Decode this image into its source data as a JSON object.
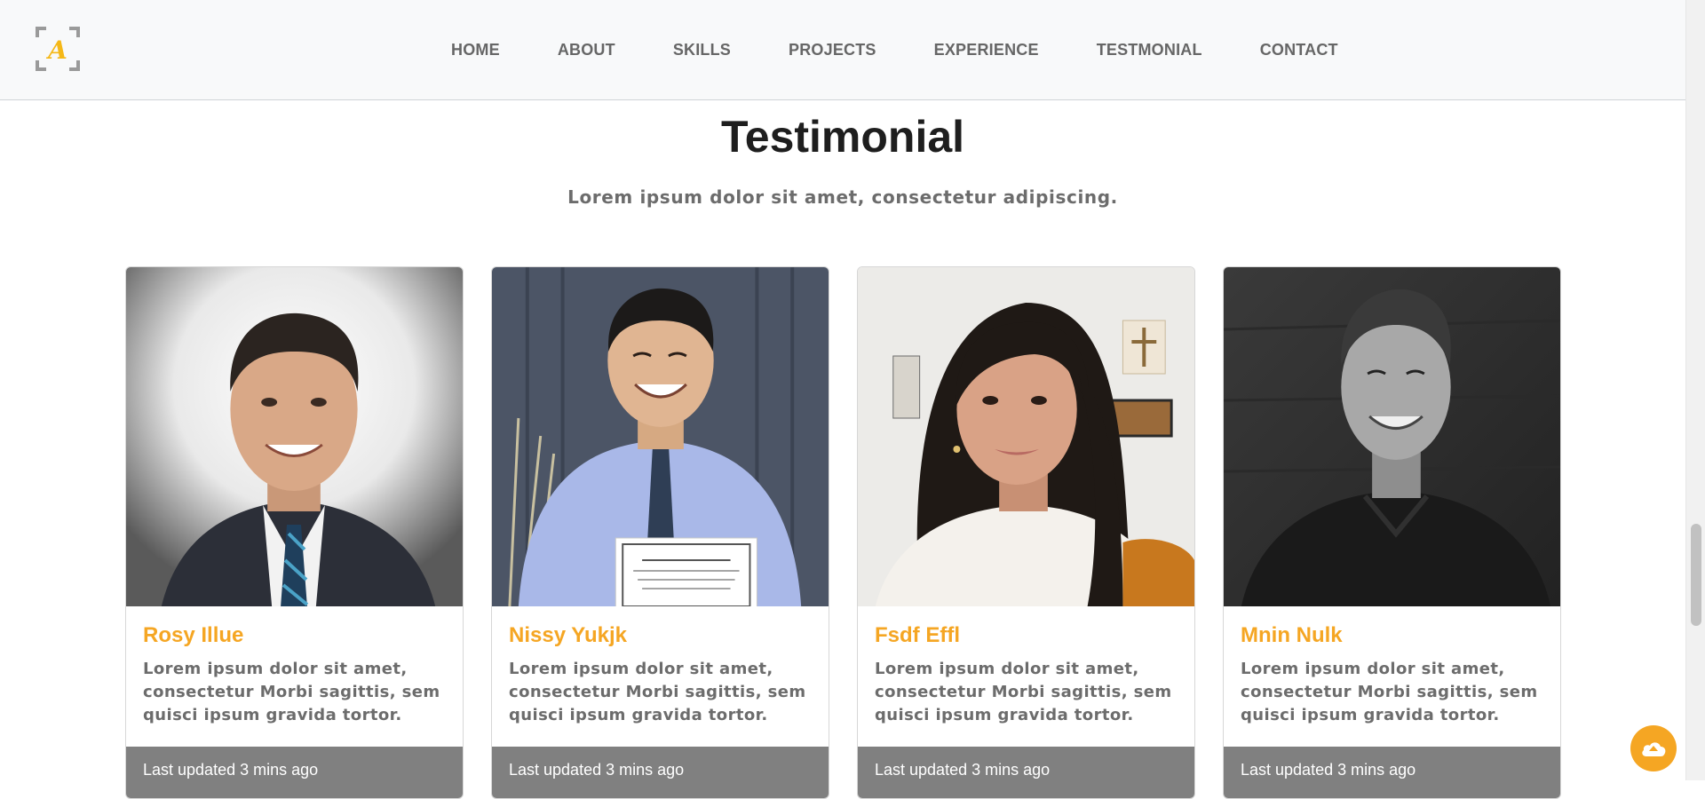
{
  "brand": {
    "logo_letter": "A",
    "accent_color": "#f5a623"
  },
  "nav": {
    "items": [
      {
        "label": "HOME"
      },
      {
        "label": "ABOUT"
      },
      {
        "label": "SKILLS"
      },
      {
        "label": "PROJECTS"
      },
      {
        "label": "EXPERIENCE"
      },
      {
        "label": "TESTMONIAL"
      },
      {
        "label": "CONTACT"
      }
    ]
  },
  "section": {
    "title": "Testimonial",
    "subtitle": "Lorem ipsum dolor sit amet, consectetur adipiscing."
  },
  "testimonials": [
    {
      "name": "Rosy Illue",
      "text": "Lorem ipsum dolor sit amet, consectetur Morbi sagittis, sem quisci ipsum gravida tortor.",
      "footer": "Last updated 3 mins ago",
      "photo": "man-in-suit-photo"
    },
    {
      "name": "Nissy Yukjk",
      "text": "Lorem ipsum dolor sit amet, consectetur Morbi sagittis, sem quisci ipsum gravida tortor.",
      "footer": "Last updated 3 mins ago",
      "photo": "man-with-certificate-photo"
    },
    {
      "name": "Fsdf Effl",
      "text": "Lorem ipsum dolor sit amet, consectetur Morbi sagittis, sem quisci ipsum gravida tortor.",
      "footer": "Last updated 3 mins ago",
      "photo": "woman-selfie-photo"
    },
    {
      "name": "Mnin Nulk",
      "text": "Lorem ipsum dolor sit amet, consectetur Morbi sagittis, sem quisci ipsum gravida tortor.",
      "footer": "Last updated 3 mins ago",
      "photo": "man-black-white-photo"
    }
  ],
  "back_to_top": {
    "icon": "cloud-up-icon"
  }
}
